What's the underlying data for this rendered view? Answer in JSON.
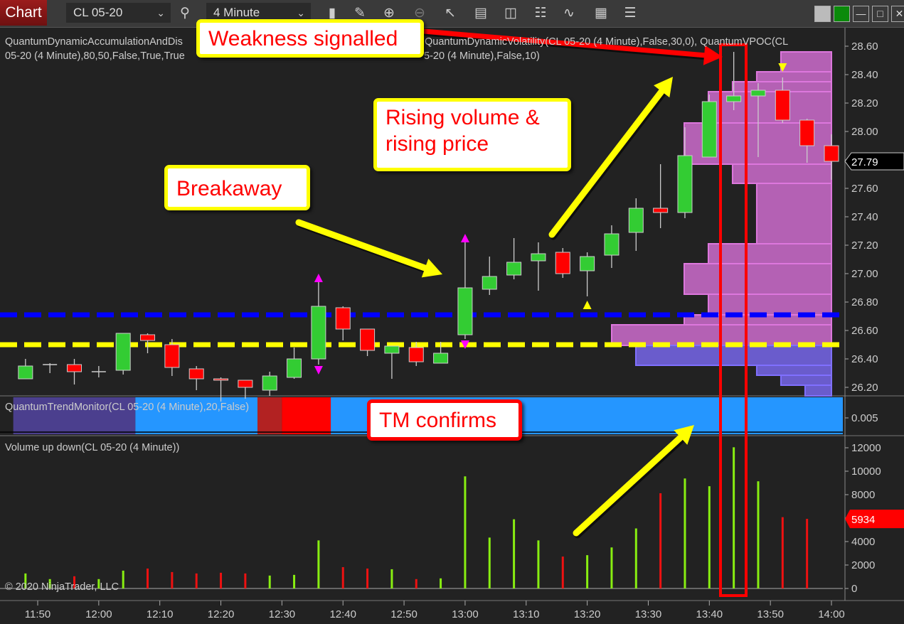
{
  "toolbar": {
    "chart_button": "Chart",
    "instrument": "CL 05-20",
    "interval": "4 Minute",
    "icons": [
      "search-icon",
      "bar-type-icon",
      "drawing-tool-icon",
      "zoom-in-icon",
      "zoom-out-icon",
      "pointer-icon",
      "data-box-icon",
      "chart-trader-icon",
      "strategies-icon",
      "indicators-icon",
      "templates-icon",
      "properties-icon"
    ],
    "window_buttons": [
      "theme-gray-button",
      "theme-green-button",
      "minimize-button",
      "maximize-button",
      "close-button"
    ]
  },
  "legends": {
    "price_line1a": "QuantumDynamicAccumulationAndDis",
    "price_line1b": "QuantumDynamicVolatility(CL 05-20 (4 Minute),False,30,0), QuantumVPOC(CL",
    "price_line2a": "05-20 (4 Minute),80,50,False,True,True",
    "price_line2b": "5-20 (4 Minute),False,10)",
    "trend_monitor": "QuantumTrendMonitor(CL 05-20 (4 Minute),20,False)",
    "volume": "Volume up down(CL 05-20 (4 Minute))",
    "copyright": "© 2020 NinjaTrader, LLC"
  },
  "annotations": {
    "weakness": "Weakness signalled",
    "breakaway": "Breakaway",
    "rising_line1": "Rising volume &",
    "rising_line2": "rising price",
    "tm_confirms": "TM confirms"
  },
  "colors": {
    "background": "#222222",
    "up_candle": "#33cc33",
    "down_candle": "#ff0000",
    "vol_up": "#88ee11",
    "vol_down": "#ee1111",
    "profile_above": "#b461b4",
    "profile_below": "#6a5ccc",
    "level_blue": "#0000ff",
    "level_yellow": "#ffff00",
    "tm_blue": "#2596ff",
    "tm_purple": "#4b3f8e",
    "tm_darkred": "#b22222",
    "tm_red": "#ff0000",
    "highlight": "#ff0000"
  },
  "chart_data": [
    {
      "type": "candlestick",
      "ylim": [
        26.1,
        28.65
      ],
      "y_ticks": [
        "28.60",
        "28.40",
        "28.20",
        "28.00",
        "27.80",
        "27.60",
        "27.40",
        "27.20",
        "27.00",
        "26.80",
        "26.60",
        "26.40",
        "26.20"
      ],
      "last_price": "27.79",
      "x_ticks": [
        "11:50",
        "12:00",
        "12:10",
        "12:20",
        "12:30",
        "12:40",
        "12:50",
        "13:00",
        "13:10",
        "13:20",
        "13:30",
        "13:40",
        "13:50",
        "14:00"
      ],
      "times": [
        "11:48",
        "11:52",
        "11:56",
        "12:00",
        "12:04",
        "12:08",
        "12:12",
        "12:16",
        "12:20",
        "12:24",
        "12:28",
        "12:32",
        "12:36",
        "12:40",
        "12:44",
        "12:48",
        "12:52",
        "12:56",
        "13:00",
        "13:04",
        "13:08",
        "13:12",
        "13:16",
        "13:20",
        "13:24",
        "13:28",
        "13:32",
        "13:36",
        "13:40",
        "13:44",
        "13:48",
        "13:52",
        "13:56",
        "14:00"
      ],
      "ohlc": [
        [
          26.26,
          26.4,
          26.26,
          26.35
        ],
        [
          26.36,
          26.37,
          26.3,
          26.36
        ],
        [
          26.36,
          26.4,
          26.22,
          26.31
        ],
        [
          26.31,
          26.35,
          26.27,
          26.31
        ],
        [
          26.32,
          26.58,
          26.29,
          26.58
        ],
        [
          26.57,
          26.58,
          26.44,
          26.53
        ],
        [
          26.5,
          26.54,
          26.28,
          26.34
        ],
        [
          26.33,
          26.35,
          26.18,
          26.26
        ],
        [
          26.26,
          26.27,
          26.1,
          26.25
        ],
        [
          26.25,
          26.25,
          26.12,
          26.2
        ],
        [
          26.18,
          26.31,
          26.14,
          26.28
        ],
        [
          26.27,
          26.48,
          26.26,
          26.4
        ],
        [
          26.4,
          26.94,
          26.36,
          26.77
        ],
        [
          26.76,
          26.77,
          26.53,
          26.61
        ],
        [
          26.61,
          26.61,
          26.42,
          26.46
        ],
        [
          26.44,
          26.49,
          26.26,
          26.49
        ],
        [
          26.48,
          26.52,
          26.35,
          26.38
        ],
        [
          26.37,
          26.52,
          26.37,
          26.44
        ],
        [
          26.57,
          27.22,
          26.54,
          26.9
        ],
        [
          26.89,
          27.12,
          26.85,
          26.98
        ],
        [
          26.99,
          27.25,
          26.96,
          27.08
        ],
        [
          27.09,
          27.22,
          26.88,
          27.14
        ],
        [
          27.15,
          27.18,
          26.97,
          27.0
        ],
        [
          27.02,
          27.15,
          26.84,
          27.12
        ],
        [
          27.13,
          27.34,
          27.04,
          27.28
        ],
        [
          27.29,
          27.53,
          27.16,
          27.46
        ],
        [
          27.46,
          27.77,
          27.32,
          27.43
        ],
        [
          27.43,
          28.03,
          27.39,
          27.83
        ],
        [
          27.82,
          28.26,
          27.82,
          28.21
        ],
        [
          28.21,
          28.56,
          28.15,
          28.25
        ],
        [
          28.25,
          28.34,
          27.82,
          28.29
        ],
        [
          28.29,
          28.38,
          28.06,
          28.08
        ],
        [
          28.08,
          28.09,
          27.78,
          27.9
        ],
        [
          27.9,
          27.98,
          27.66,
          27.79
        ]
      ],
      "levels": [
        {
          "price": 26.71,
          "color": "#0000ff"
        },
        {
          "price": 26.5,
          "color": "#ffff00"
        }
      ],
      "signals": [
        {
          "time": "12:36",
          "kind": "up",
          "color": "#ff00ff"
        },
        {
          "time": "12:36",
          "kind": "down",
          "color": "#ff00ff"
        },
        {
          "time": "13:00",
          "kind": "up",
          "color": "#ff00ff"
        },
        {
          "time": "13:00",
          "kind": "down",
          "color": "#ff00ff"
        },
        {
          "time": "13:20",
          "kind": "up",
          "color": "#ffff00"
        },
        {
          "time": "13:52",
          "kind": "down",
          "color": "#ffff00"
        }
      ],
      "volume_profile": [
        {
          "from": 28.42,
          "to": 28.56,
          "rel": 0.23
        },
        {
          "from": 28.35,
          "to": 28.42,
          "rel": 0.34
        },
        {
          "from": 28.28,
          "to": 28.35,
          "rel": 0.45
        },
        {
          "from": 28.06,
          "to": 28.28,
          "rel": 0.56
        },
        {
          "from": 27.77,
          "to": 28.06,
          "rel": 0.67
        },
        {
          "from": 27.635,
          "to": 27.77,
          "rel": 0.45
        },
        {
          "from": 27.21,
          "to": 27.635,
          "rel": 0.34
        },
        {
          "from": 27.07,
          "to": 27.21,
          "rel": 0.56
        },
        {
          "from": 26.855,
          "to": 27.07,
          "rel": 0.67
        },
        {
          "from": 26.71,
          "to": 26.855,
          "rel": 0.56
        },
        {
          "from": 26.64,
          "to": 26.71,
          "rel": 0.67
        },
        {
          "from": 26.495,
          "to": 26.64,
          "rel": 1.0
        },
        {
          "from": 26.355,
          "to": 26.495,
          "rel": 0.89,
          "below": true
        },
        {
          "from": 26.285,
          "to": 26.355,
          "rel": 0.34,
          "below": true
        },
        {
          "from": 26.215,
          "to": 26.285,
          "rel": 0.23,
          "below": true
        },
        {
          "from": 26.14,
          "to": 26.215,
          "rel": 0.12,
          "below": true
        }
      ]
    },
    {
      "type": "band",
      "name": "QuantumTrendMonitor",
      "y_ticks": [
        "0.005"
      ],
      "segments": [
        {
          "from": "11:46",
          "to": "12:06",
          "color": "#4b3f8e"
        },
        {
          "from": "12:06",
          "to": "12:26",
          "color": "#2596ff"
        },
        {
          "from": "12:26",
          "to": "12:30",
          "color": "#b22222"
        },
        {
          "from": "12:30",
          "to": "12:38",
          "color": "#ff0000"
        },
        {
          "from": "12:38",
          "to": "14:02",
          "color": "#2596ff"
        }
      ]
    },
    {
      "type": "bar",
      "ylim": [
        0,
        12500
      ],
      "y_ticks": [
        "12000",
        "10000",
        "8000",
        "6000",
        "4000",
        "2000",
        "0"
      ],
      "last_value": "5934",
      "volumes": [
        1280,
        800,
        1040,
        800,
        1520,
        1700,
        1400,
        1280,
        1340,
        1280,
        1100,
        1160,
        4100,
        1820,
        1700,
        1640,
        800,
        860,
        9560,
        4340,
        5900,
        4100,
        2720,
        2840,
        3500,
        5120,
        8120,
        9380,
        8720,
        12040,
        9140,
        6080,
        5934,
        null
      ],
      "direction": [
        "up",
        "up",
        "down",
        "up",
        "up",
        "down",
        "down",
        "down",
        "down",
        "down",
        "up",
        "up",
        "up",
        "down",
        "down",
        "up",
        "down",
        "up",
        "up",
        "up",
        "up",
        "up",
        "down",
        "up",
        "up",
        "up",
        "down",
        "up",
        "up",
        "up",
        "up",
        "down",
        "down",
        "down"
      ]
    }
  ]
}
